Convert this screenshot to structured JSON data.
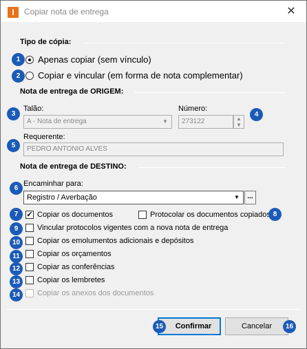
{
  "window": {
    "title": "Copiar nota de entrega",
    "app_icon_letter": "I",
    "close_glyph": "✕"
  },
  "copy_type": {
    "title": "Tipo de cópia:",
    "options": [
      {
        "label": "Apenas copiar (sem vínculo)",
        "selected": true,
        "badge": "1"
      },
      {
        "label": "Copiar e vincular (em forma de nota complementar)",
        "selected": false,
        "badge": "2"
      }
    ]
  },
  "origin": {
    "title": "Nota de entrega de ORIGEM:",
    "talao_label": "Talão:",
    "talao_value": "A  - Nota de entrega",
    "talao_badge": "3",
    "numero_label": "Número:",
    "numero_value": "273122",
    "numero_badge": "4",
    "requerente_label": "Requerente:",
    "requerente_value": "PEDRO ANTONIO ALVES",
    "requerente_badge": "5"
  },
  "destination": {
    "title": "Nota de entrega de DESTINO:",
    "encaminhar_label": "Encaminhar para:",
    "encaminhar_value": "Registro / Averbação",
    "encaminhar_badge": "6",
    "dots_label": "...",
    "options": [
      {
        "label": "Copiar os documentos",
        "checked": true,
        "enabled": true,
        "badge": "7"
      },
      {
        "label": "Protocolar os documentos copiados",
        "checked": false,
        "enabled": true,
        "badge": "8"
      },
      {
        "label": "Vincular protocolos vigentes com a nova nota de entrega",
        "checked": false,
        "enabled": true,
        "badge": "9"
      },
      {
        "label": "Copiar os emolumentos adicionais e depósitos",
        "checked": false,
        "enabled": true,
        "badge": "10"
      },
      {
        "label": "Copiar os orçamentos",
        "checked": false,
        "enabled": true,
        "badge": "11"
      },
      {
        "label": "Copiar as conferências",
        "checked": false,
        "enabled": true,
        "badge": "12"
      },
      {
        "label": "Copiar os lembretes",
        "checked": false,
        "enabled": true,
        "badge": "13"
      },
      {
        "label": "Copiar os anexos dos documentos",
        "checked": false,
        "enabled": false,
        "badge": "14"
      }
    ]
  },
  "buttons": {
    "confirm_label": "Confirmar",
    "confirm_badge": "15",
    "cancel_label": "Cancelar",
    "cancel_badge": "16"
  },
  "colors": {
    "badge": "#1b5bb7",
    "app_icon": "#e8731c",
    "primary_border": "#0078d7"
  }
}
